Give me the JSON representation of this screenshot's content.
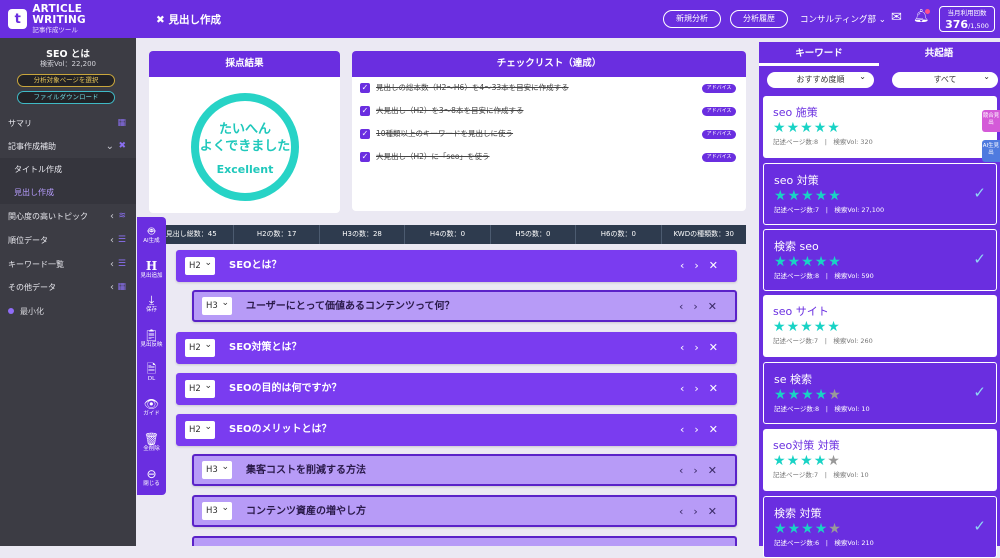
{
  "brand": {
    "name": "ARTICLE WRITING",
    "subtitle": "記事作成ツール",
    "logo_letter": "t"
  },
  "topbar": {
    "title": "見出し作成",
    "buttons": [
      "新規分析",
      "分析履歴"
    ],
    "account": "コンサルティング部",
    "usage_label": "当月利用回数",
    "usage_value": "376",
    "usage_max": "/1,500"
  },
  "sidebar": {
    "keyword": "SEO とは",
    "volume": "検索Vol：22,200",
    "pill_select": "分析対象ページを選択",
    "pill_download": "ファイルダウンロード",
    "items": [
      {
        "label": "サマリ",
        "icon": "grid-icon"
      },
      {
        "label": "記事作成補助",
        "icon": "tools-icon"
      },
      {
        "label": "タイトル作成"
      },
      {
        "label": "見出し作成"
      },
      {
        "label": "関心度の高いトピック",
        "icon": "wifi-icon"
      },
      {
        "label": "順位データ",
        "icon": "list-icon"
      },
      {
        "label": "キーワード一覧",
        "icon": "list-icon"
      },
      {
        "label": "その他データ",
        "icon": "grid-icon"
      },
      {
        "label": "最小化"
      }
    ]
  },
  "tools": [
    {
      "label": "AI生成",
      "icon": "robot-icon"
    },
    {
      "label": "見出追加",
      "icon": "heading-icon"
    },
    {
      "label": "保存",
      "icon": "save-icon"
    },
    {
      "label": "見出反映",
      "icon": "clipboard-icon"
    },
    {
      "label": "DL",
      "icon": "file-download-icon"
    },
    {
      "label": "ガイド",
      "icon": "eye-icon"
    },
    {
      "label": "全削除",
      "icon": "trash-icon"
    },
    {
      "label": "閉じる",
      "icon": "minus-circle-icon"
    }
  ],
  "score": {
    "header": "採点結果",
    "message_line1": "たいへん",
    "message_line2": "よくできました",
    "grade": "Excellent"
  },
  "checklist": {
    "header": "チェックリスト（達成）",
    "advice_label": "アドバイス",
    "items": [
      "見出しの総本数（H2〜H6）を4〜33本を目安に作成する",
      "大見出し（H2）を3〜8本を目安に作成する",
      "10種類以上のキーワードを見出しに使う",
      "大見出し（H2）に「seo」を使う"
    ]
  },
  "stats": [
    "見出し総数：45",
    "H2の数：17",
    "H3の数：28",
    "H4の数：0",
    "H5の数：0",
    "H6の数：0",
    "KWDの種類数：30"
  ],
  "headings": [
    {
      "level": "H2",
      "text": "SEOとは？"
    },
    {
      "level": "H3",
      "text": "ユーザーにとって価値あるコンテンツって何？"
    },
    {
      "level": "H2",
      "text": "SEO対策とは？"
    },
    {
      "level": "H2",
      "text": "SEOの目的は何ですか？"
    },
    {
      "level": "H2",
      "text": "SEOのメリットとは？"
    },
    {
      "level": "H3",
      "text": "集客コストを削減する方法"
    },
    {
      "level": "H3",
      "text": "コンテンツ資産の増やし方"
    }
  ],
  "right_panel": {
    "tabs": [
      "キーワード",
      "共起語"
    ],
    "filter1": "おすすめ度順",
    "filter2": "すべて",
    "side_tabs": [
      "競合見出",
      "AI生見出"
    ],
    "keywords": [
      {
        "keyword": "seo 施策",
        "stars": 5,
        "pages": "記述ページ数:8",
        "volume": "検索Vol: 320",
        "checked": false
      },
      {
        "keyword": "seo 対策",
        "stars": 5,
        "pages": "記述ページ数:7",
        "volume": "検索Vol: 27,100",
        "checked": true
      },
      {
        "keyword": "検索 seo",
        "stars": 5,
        "pages": "記述ページ数:8",
        "volume": "検索Vol: 590",
        "checked": true
      },
      {
        "keyword": "seo サイト",
        "stars": 5,
        "pages": "記述ページ数:7",
        "volume": "検索Vol: 260",
        "checked": false
      },
      {
        "keyword": "se 検索",
        "stars": 4,
        "pages": "記述ページ数:8",
        "volume": "検索Vol: 10",
        "checked": true
      },
      {
        "keyword": "seo対策 対策",
        "stars": 4,
        "pages": "記述ページ数:7",
        "volume": "検索Vol: 10",
        "checked": false
      },
      {
        "keyword": "検索 対策",
        "stars": 4,
        "pages": "記述ページ数:6",
        "volume": "検索Vol: 210",
        "checked": true
      }
    ]
  },
  "colors": {
    "primary": "#6a2ee0",
    "teal": "#19d3c5",
    "sidebar": "#3c3c44"
  }
}
